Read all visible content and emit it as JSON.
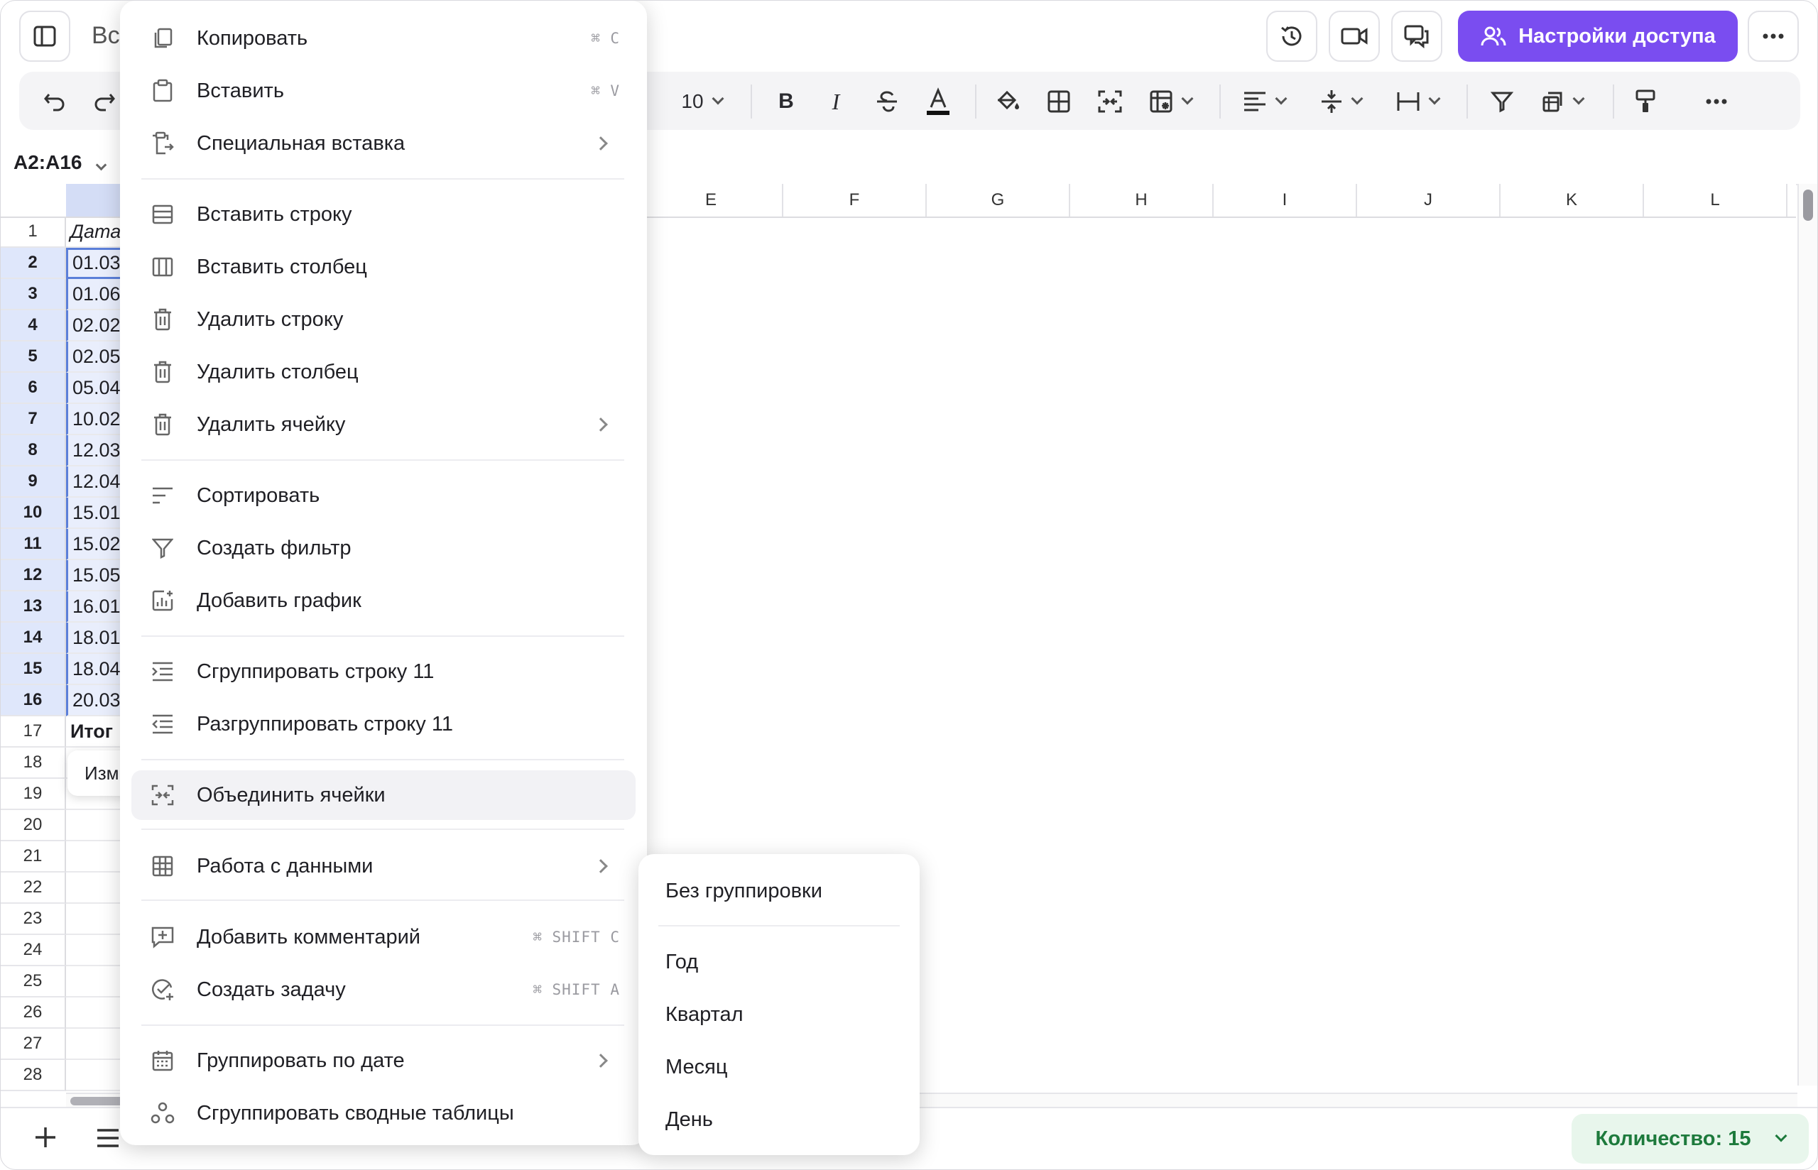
{
  "header": {
    "doc_title": "Вс",
    "share_label": "Настройки доступа"
  },
  "toolbar": {
    "font_size": "10"
  },
  "formula": {
    "name_box": "A2:A16"
  },
  "grid": {
    "columns": [
      "E",
      "F",
      "G",
      "H",
      "I",
      "J",
      "K",
      "L"
    ],
    "rows": [
      {
        "num": "1",
        "a": "Дата",
        "selected": false,
        "style": "italic"
      },
      {
        "num": "2",
        "a": "01.03",
        "selected": true
      },
      {
        "num": "3",
        "a": "01.06",
        "selected": true
      },
      {
        "num": "4",
        "a": "02.02",
        "selected": true
      },
      {
        "num": "5",
        "a": "02.05",
        "selected": true
      },
      {
        "num": "6",
        "a": "05.04",
        "selected": true
      },
      {
        "num": "7",
        "a": "10.02",
        "selected": true
      },
      {
        "num": "8",
        "a": "12.03",
        "selected": true
      },
      {
        "num": "9",
        "a": "12.04",
        "selected": true
      },
      {
        "num": "10",
        "a": "15.01",
        "selected": true
      },
      {
        "num": "11",
        "a": "15.02",
        "selected": true
      },
      {
        "num": "12",
        "a": "15.05",
        "selected": true
      },
      {
        "num": "13",
        "a": "16.01",
        "selected": true
      },
      {
        "num": "14",
        "a": "18.01",
        "selected": true
      },
      {
        "num": "15",
        "a": "18.04",
        "selected": true
      },
      {
        "num": "16",
        "a": "20.03",
        "selected": true
      },
      {
        "num": "17",
        "a": "Итог",
        "selected": false,
        "style": "bold"
      },
      {
        "num": "18",
        "a": "",
        "selected": false
      },
      {
        "num": "19",
        "a": "",
        "selected": false
      },
      {
        "num": "20",
        "a": "",
        "selected": false
      },
      {
        "num": "21",
        "a": "",
        "selected": false
      },
      {
        "num": "22",
        "a": "",
        "selected": false
      },
      {
        "num": "23",
        "a": "",
        "selected": false
      },
      {
        "num": "24",
        "a": "",
        "selected": false
      },
      {
        "num": "25",
        "a": "",
        "selected": false
      },
      {
        "num": "26",
        "a": "",
        "selected": false
      },
      {
        "num": "27",
        "a": "",
        "selected": false
      },
      {
        "num": "28",
        "a": "",
        "selected": false
      }
    ],
    "popup_fragment": "Изм"
  },
  "context_menu": {
    "copy": {
      "label": "Копировать",
      "shortcut": "⌘ C"
    },
    "paste": {
      "label": "Вставить",
      "shortcut": "⌘ V"
    },
    "paste_special": {
      "label": "Специальная вставка"
    },
    "insert_row": {
      "label": "Вставить строку"
    },
    "insert_column": {
      "label": "Вставить столбец"
    },
    "delete_row": {
      "label": "Удалить строку"
    },
    "delete_column": {
      "label": "Удалить столбец"
    },
    "delete_cell": {
      "label": "Удалить ячейку"
    },
    "sort": {
      "label": "Сортировать"
    },
    "create_filter": {
      "label": "Создать фильтр"
    },
    "add_chart": {
      "label": "Добавить график"
    },
    "group_row": {
      "label": "Сгруппировать строку 11"
    },
    "ungroup_row": {
      "label": "Разгруппировать строку 11"
    },
    "merge_cells": {
      "label": "Объединить ячейки"
    },
    "data_tools": {
      "label": "Работа с данными"
    },
    "add_comment": {
      "label": "Добавить комментарий",
      "shortcut": "⌘ SHIFT C"
    },
    "create_task": {
      "label": "Создать задачу",
      "shortcut": "⌘ SHIFT A"
    },
    "group_by_date": {
      "label": "Группировать по дате"
    },
    "group_pivot": {
      "label": "Сгруппировать сводные таблицы"
    }
  },
  "submenu": {
    "none": "Без группировки",
    "year": "Год",
    "quarter": "Квартал",
    "month": "Месяц",
    "day": "День"
  },
  "status": {
    "count_label": "Количество: 15"
  },
  "colors": {
    "accent": "#7a4df0",
    "selection": "#e9eefc",
    "count_text": "#1d7a3c"
  }
}
